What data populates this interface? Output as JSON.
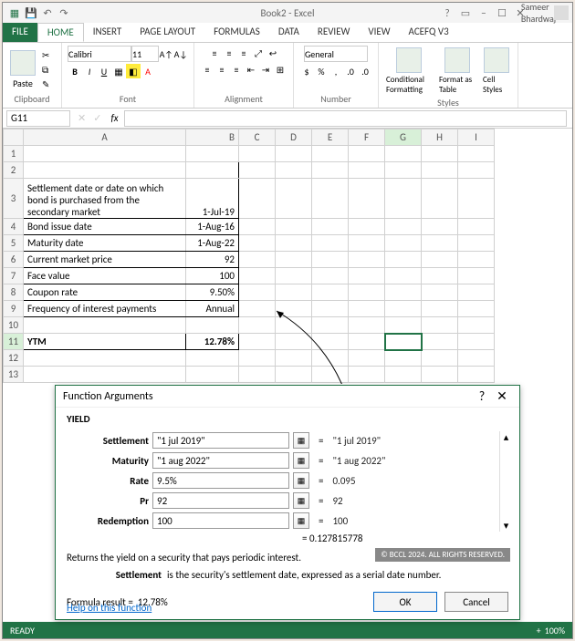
{
  "title": "Book2 - Excel",
  "user": "Sameer Bhardwaj",
  "tabs": {
    "file": "FILE",
    "home": "HOME",
    "insert": "INSERT",
    "layout": "PAGE LAYOUT",
    "formulas": "FORMULAS",
    "data": "DATA",
    "review": "REVIEW",
    "view": "VIEW",
    "acefq": "ACEFQ V3"
  },
  "ribbon": {
    "clipboard": {
      "label": "Clipboard",
      "paste": "Paste"
    },
    "font": {
      "label": "Font",
      "name": "Calibri",
      "size": "11"
    },
    "alignment": {
      "label": "Alignment"
    },
    "number": {
      "label": "Number",
      "format": "General"
    },
    "styles": {
      "label": "Styles",
      "cond": "Conditional Formatting",
      "table": "Format as Table",
      "cell": "Cell Styles"
    }
  },
  "namebox": "G11",
  "fx": "fx",
  "sheet": {
    "cols": [
      "A",
      "B",
      "C",
      "D",
      "E",
      "F",
      "G",
      "H",
      "I"
    ],
    "rows": [
      {
        "n": "1",
        "a": "",
        "b": ""
      },
      {
        "n": "2",
        "a": "",
        "b": ""
      },
      {
        "n": "3",
        "a": "Settlement date or date on which bond is purchased from the secondary market",
        "b": "1-Jul-19"
      },
      {
        "n": "4",
        "a": "Bond issue date",
        "b": "1-Aug-16"
      },
      {
        "n": "5",
        "a": "Maturity date",
        "b": "1-Aug-22"
      },
      {
        "n": "6",
        "a": "Current market price",
        "b": "92"
      },
      {
        "n": "7",
        "a": "Face value",
        "b": "100"
      },
      {
        "n": "8",
        "a": "Coupon rate",
        "b": "9.50%"
      },
      {
        "n": "9",
        "a": "Frequency of interest payments",
        "b": "Annual"
      },
      {
        "n": "10",
        "a": "",
        "b": ""
      },
      {
        "n": "11",
        "a": "YTM",
        "b": "12.78%"
      },
      {
        "n": "12",
        "a": "",
        "b": ""
      },
      {
        "n": "13",
        "a": "",
        "b": ""
      }
    ]
  },
  "status": {
    "ready": "READY",
    "zoom": "100%"
  },
  "dialog": {
    "title": "Function Arguments",
    "fn": "YIELD",
    "args": [
      {
        "label": "Settlement",
        "value": "\"1 jul 2019\"",
        "parsed": "\"1 jul 2019\""
      },
      {
        "label": "Maturity",
        "value": "\"1 aug 2022\"",
        "parsed": "\"1 aug 2022\""
      },
      {
        "label": "Rate",
        "value": "9.5%",
        "parsed": "0.095"
      },
      {
        "label": "Pr",
        "value": "92",
        "parsed": "92"
      },
      {
        "label": "Redemption",
        "value": "100",
        "parsed": "100"
      }
    ],
    "raw_result": "= 0.127815778",
    "desc": "Returns the yield on a security that pays periodic interest.",
    "param_name": "Settlement",
    "param_desc": "is the security's settlement date, expressed as a serial date number.",
    "watermark": "© BCCL 2024. ALL RIGHTS RESERVED.",
    "formula_result_label": "Formula result =",
    "formula_result": "12.78%",
    "help": "Help on this function",
    "ok": "OK",
    "cancel": "Cancel"
  }
}
